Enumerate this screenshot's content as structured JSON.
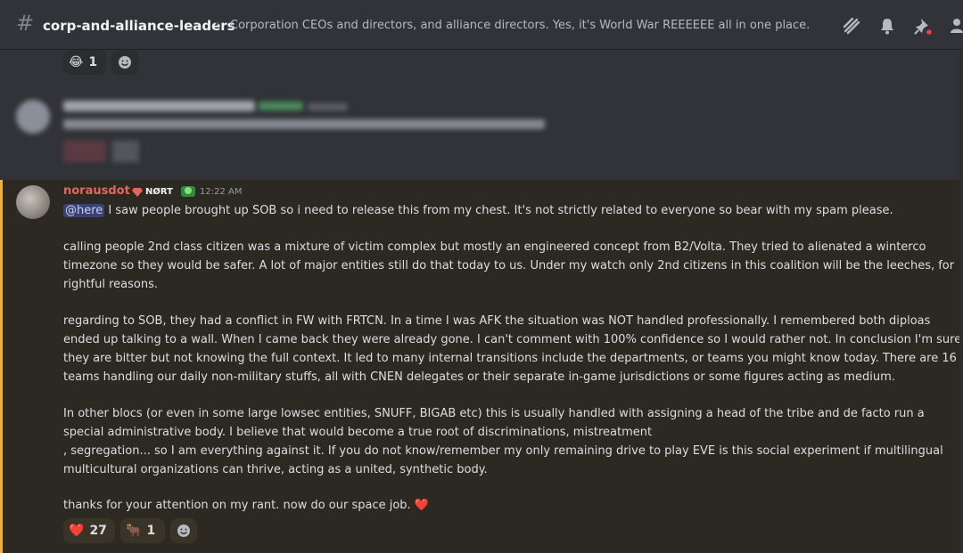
{
  "header": {
    "channel_name": "corp-and-alliance-leaders",
    "topic": "Corporation CEOs and directors, and alliance directors. Yes, it's World War REEEEEE all in one place."
  },
  "top_reactions": [
    {
      "emoji": "😂",
      "count": "1"
    }
  ],
  "message": {
    "author": "norausdot",
    "tag": "NØRT",
    "time": "12:22 AM",
    "mention": "@here",
    "lines": [
      " I saw people brought up SOB so i need to release this from my chest. It's not strictly related to everyone so bear with my spam please.",
      "",
      "calling people 2nd class citizen was a mixture of victim complex but mostly an engineered concept from B2/Volta. They tried to alienated a winterco",
      "timezone so they would be safer. A lot of major entities still do that today to us.  Under my watch only 2nd citizens in this coalition will be the leeches, for",
      "rightful reasons.",
      "",
      "regarding to SOB, they had a conflict in FW with FRTCN. In a time I was AFK the situation was NOT handled professionally. I remembered both diploas",
      "ended up talking to a wall. When I came back they were already gone. I can't comment with 100% confidence so I would rather not. In conclusion I'm sure",
      "they are bitter but not knowing the full context.  It led to many internal transitions include the departments, or teams you might know today.  There are 16",
      "teams handling our daily non-military stuffs, all with CNEN delegates or their separate in-game jurisdictions or some figures acting as medium.",
      "",
      "In other blocs (or even in some large lowsec entities, SNUFF, BIGAB etc) this is usually handled with assigning a head of the tribe and de facto run a",
      "special administrative body.  I believe that would become a true root of discriminations, mistreatment",
      " , segregation... so I am everything against it.  If you do not know/remember my only remaining drive to play EVE is this social experiment if multilingual",
      "multicultural organizations can thrive, acting as a united, synthetic body.",
      "",
      "thanks for your attention on my rant. now do our space job. ❤️"
    ],
    "reactions": [
      {
        "emoji": "❤️",
        "count": "27"
      },
      {
        "emoji": "🐂",
        "count": "1"
      }
    ]
  },
  "colors": {
    "background": "#313338",
    "highlight": "#2c2822",
    "highlight_bar": "#f0b232",
    "author": "#e0675a"
  }
}
